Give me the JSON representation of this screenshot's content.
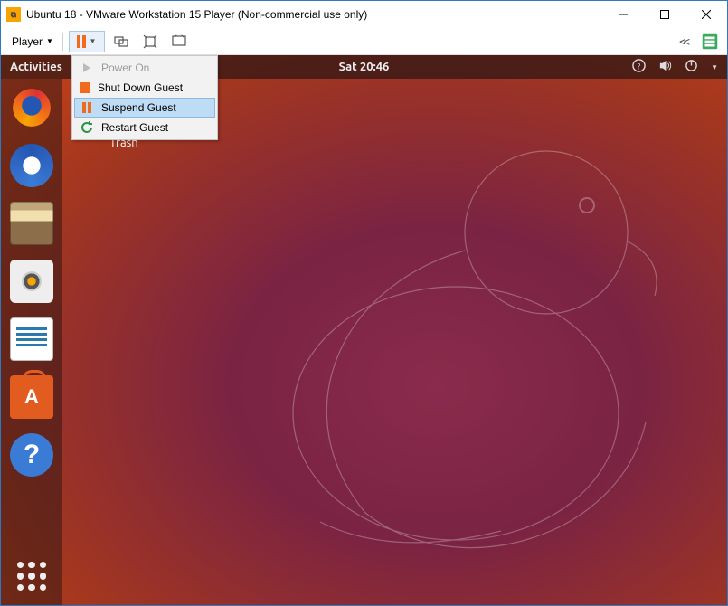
{
  "titlebar": {
    "title": "Ubuntu 18 - VMware Workstation 15 Player (Non-commercial use only)"
  },
  "toolbar": {
    "player_label": "Player",
    "cycle_label": "≪"
  },
  "dropdown": {
    "items": [
      {
        "label": "Power On",
        "icon": "poweron",
        "state": "disabled"
      },
      {
        "label": "Shut Down Guest",
        "icon": "shutdown",
        "state": ""
      },
      {
        "label": "Suspend Guest",
        "icon": "suspend",
        "state": "selected"
      },
      {
        "label": "Restart Guest",
        "icon": "restart",
        "state": ""
      }
    ]
  },
  "guest": {
    "activities": "Activities",
    "clock": "Sat 20:46",
    "desktop": {
      "trash_label": "Trash"
    }
  }
}
